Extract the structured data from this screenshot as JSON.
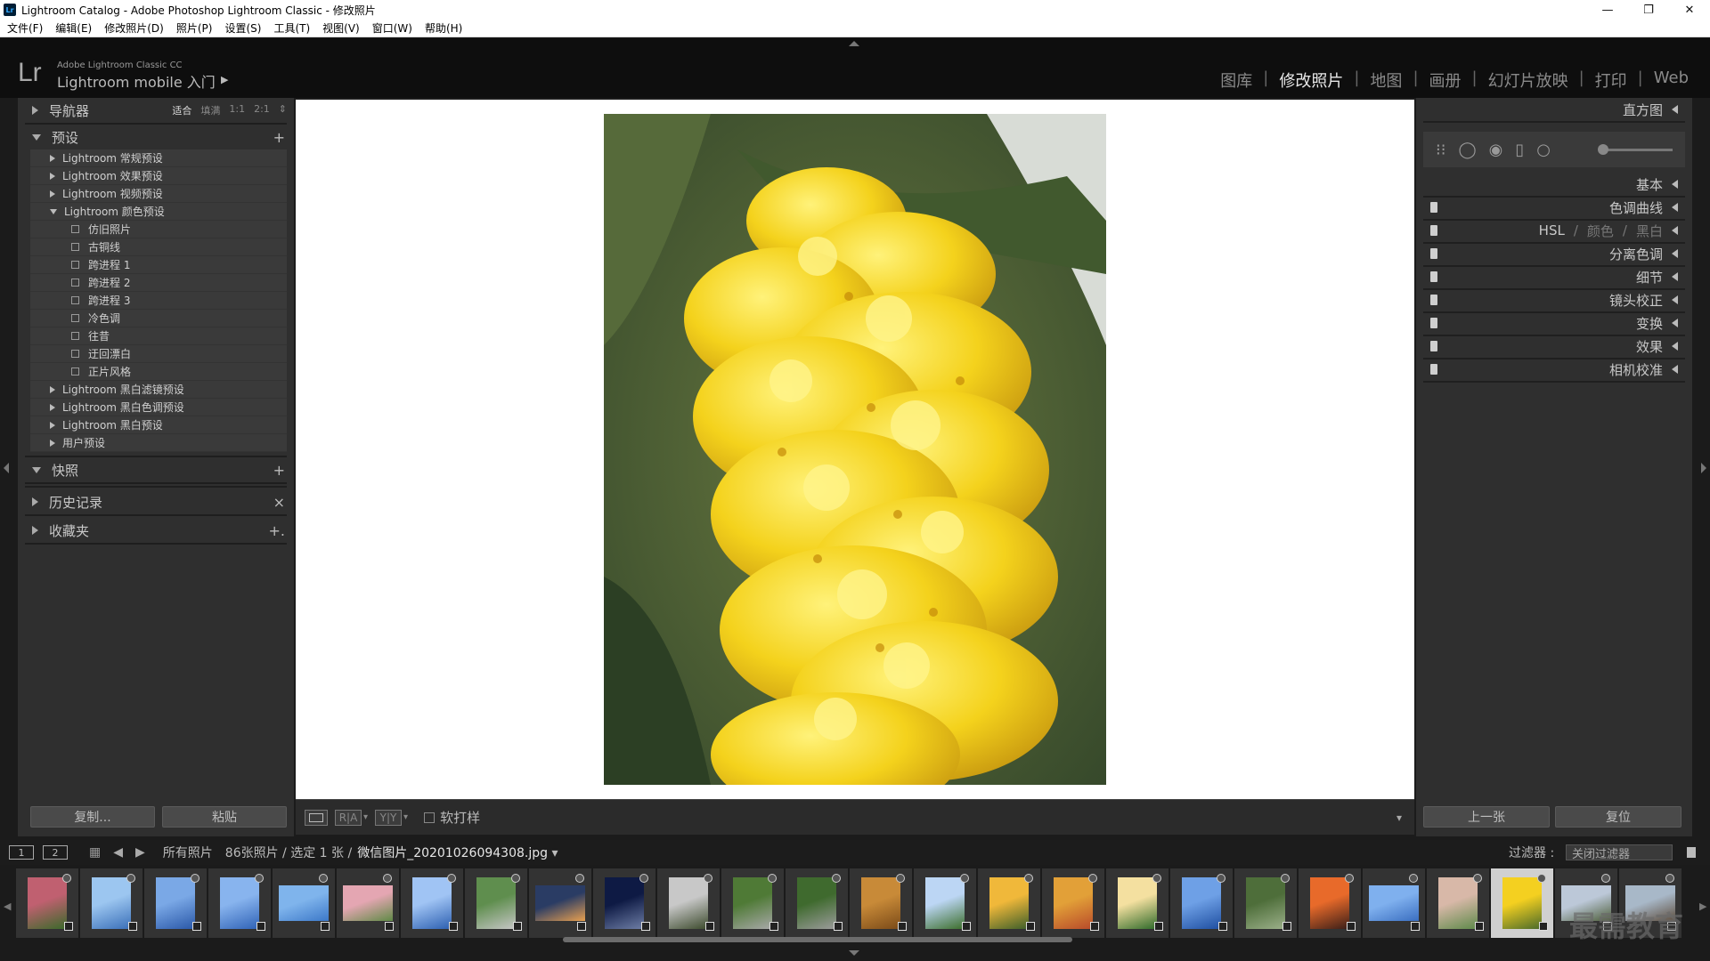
{
  "window": {
    "title": "Lightroom Catalog - Adobe Photoshop Lightroom Classic - 修改照片",
    "app_icon": "Lr",
    "minimize": "—",
    "maximize": "❐",
    "close": "✕"
  },
  "menu": [
    "文件(F)",
    "编辑(E)",
    "修改照片(D)",
    "照片(P)",
    "设置(S)",
    "工具(T)",
    "视图(V)",
    "窗口(W)",
    "帮助(H)"
  ],
  "identity": {
    "logo": "Lr",
    "small": "Adobe Lightroom Classic CC",
    "big": "Lightroom mobile 入门",
    "arrow": "▶"
  },
  "modules": [
    "图库",
    "修改照片",
    "地图",
    "画册",
    "幻灯片放映",
    "打印",
    "Web"
  ],
  "active_module": "修改照片",
  "left": {
    "navigator": {
      "label": "导航器",
      "opts": [
        "适合",
        "填满",
        "1:1",
        "2:1",
        "⇕"
      ],
      "active_opt": "适合"
    },
    "presets": {
      "label": "预设",
      "add": "+",
      "groups": [
        {
          "label": "Lightroom 常规预设",
          "expanded": false
        },
        {
          "label": "Lightroom 效果预设",
          "expanded": false
        },
        {
          "label": "Lightroom 视频预设",
          "expanded": false
        },
        {
          "label": "Lightroom 颜色预设",
          "expanded": true
        }
      ],
      "color_items": [
        "仿旧照片",
        "古铜线",
        "跨进程 1",
        "跨进程 2",
        "跨进程 3",
        "冷色调",
        "往昔",
        "迂回漂白",
        "正片风格"
      ],
      "groups_after": [
        "Lightroom 黑白滤镜预设",
        "Lightroom 黑白色调预设",
        "Lightroom 黑白预设",
        "用户预设"
      ]
    },
    "snapshots": {
      "label": "快照",
      "add": "+"
    },
    "history": {
      "label": "历史记录",
      "clear": "×"
    },
    "collections": {
      "label": "收藏夹",
      "add": "+."
    },
    "copy_btn": "复制...",
    "paste_btn": "粘贴"
  },
  "toolbar": {
    "softproof": "软打样",
    "view_ab": "R|A",
    "view_yy": "Y|Y",
    "dd": "▾"
  },
  "right": {
    "histogram": "直方图",
    "panels": [
      {
        "label": "基本",
        "toggle": false
      },
      {
        "label": "色调曲线",
        "toggle": true
      },
      {
        "label": "HSL",
        "toggle": true,
        "extra": [
          "颜色",
          "黑白"
        ]
      },
      {
        "label": "分离色调",
        "toggle": true
      },
      {
        "label": "细节",
        "toggle": true
      },
      {
        "label": "镜头校正",
        "toggle": true
      },
      {
        "label": "变换",
        "toggle": true
      },
      {
        "label": "效果",
        "toggle": true
      },
      {
        "label": "相机校准",
        "toggle": true
      }
    ],
    "prev_btn": "上一张",
    "reset_btn": "复位"
  },
  "filmstrip_header": {
    "view1": "1",
    "view2": "2",
    "source": "所有照片",
    "count": "86张照片 / 选定 1 张 /",
    "filename": "微信图片_20201026094308.jpg",
    "filter_label": "过滤器 :",
    "filter_value": "关闭过滤器"
  },
  "filmstrip": {
    "thumbs": [
      {
        "c1": "#c06070",
        "c2": "#3a6a2a",
        "portrait": true
      },
      {
        "c1": "#9cc6f0",
        "c2": "#3a6fb8",
        "portrait": true
      },
      {
        "c1": "#7aa8e6",
        "c2": "#2a58a8",
        "portrait": true
      },
      {
        "c1": "#88b4ee",
        "c2": "#2f62b6",
        "portrait": true
      },
      {
        "c1": "#7fb4ec",
        "c2": "#3c78c8",
        "portrait": false
      },
      {
        "c1": "#e4a6b2",
        "c2": "#5f8a46",
        "portrait": false
      },
      {
        "c1": "#a0c4f4",
        "c2": "#2c5fb0",
        "portrait": true
      },
      {
        "c1": "#5f8e4e",
        "c2": "#c6c6c6",
        "portrait": true
      },
      {
        "c1": "#2a3c64",
        "c2": "#e8a050",
        "portrait": false
      },
      {
        "c1": "#0e1a44",
        "c2": "#6e7ea6",
        "portrait": true
      },
      {
        "c1": "#c8c8c8",
        "c2": "#3c4a2c",
        "portrait": true
      },
      {
        "c1": "#4f7a36",
        "c2": "#a8a8a8",
        "portrait": true
      },
      {
        "c1": "#3f6a2e",
        "c2": "#9c9c9c",
        "portrait": true
      },
      {
        "c1": "#c88a38",
        "c2": "#7a4a18",
        "portrait": true
      },
      {
        "c1": "#bcd6f4",
        "c2": "#3c6e2a",
        "portrait": true
      },
      {
        "c1": "#f0b83a",
        "c2": "#3c5e2a",
        "portrait": true
      },
      {
        "c1": "#e2a038",
        "c2": "#b84a2a",
        "portrait": true
      },
      {
        "c1": "#f4e0a0",
        "c2": "#2e6a2a",
        "portrait": true
      },
      {
        "c1": "#6ea0e6",
        "c2": "#1e4ea0",
        "portrait": true
      },
      {
        "c1": "#4e6e3a",
        "c2": "#9cb08a",
        "portrait": true
      },
      {
        "c1": "#e86a2a",
        "c2": "#3a1e18",
        "portrait": true
      },
      {
        "c1": "#7fb0ee",
        "c2": "#3a6ec0",
        "portrait": false
      },
      {
        "c1": "#d8b8a8",
        "c2": "#5e8a4a",
        "portrait": true
      },
      {
        "c1": "#f4d020",
        "c2": "#4a6a2a",
        "portrait": true,
        "active": true
      },
      {
        "c1": "#bcc8d8",
        "c2": "#4e5e3a",
        "portrait": false
      },
      {
        "c1": "#a8b8c8",
        "c2": "#5e4e3e",
        "portrait": false
      }
    ],
    "watermark": "最需教育"
  },
  "colors": {
    "panel_bg": "#2f2f2f",
    "canvas_bg": "#ffffff",
    "chrome_bg": "#0e0e0e",
    "active_text": "#e8e8e8"
  }
}
